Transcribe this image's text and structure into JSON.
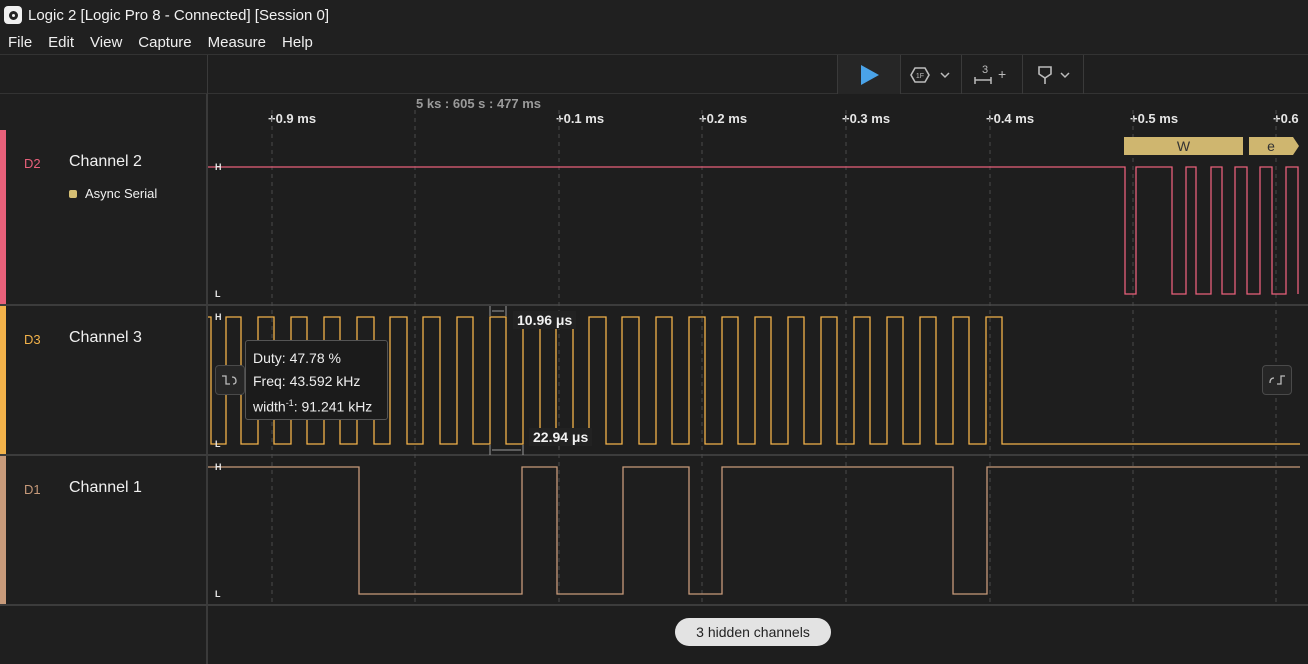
{
  "window": {
    "title": "Logic 2 [Logic Pro 8 - Connected] [Session 0]"
  },
  "menu": [
    "File",
    "Edit",
    "View",
    "Capture",
    "Measure",
    "Help"
  ],
  "toolbar": {
    "play_icon": "play-icon",
    "trigger_icon": "trigger-icon",
    "trigger_text": "1F",
    "measure_icon": "measure-icon",
    "measure_number": "3",
    "measure_plus": "+",
    "marker_icon": "marker-icon",
    "accent_color": "#4aa3e8"
  },
  "timeline": {
    "origin": "5 ks : 605 s : 477 ms",
    "ticks": [
      "+0.9 ms",
      "+0.1 ms",
      "+0.2 ms",
      "+0.3 ms",
      "+0.4 ms",
      "+0.5 ms",
      "+0.6"
    ]
  },
  "channels": [
    {
      "id": "D2",
      "name": "Channel 2",
      "color": "#e8607a",
      "analyzer": "Async Serial"
    },
    {
      "id": "D3",
      "name": "Channel 3",
      "color": "#f2b24a"
    },
    {
      "id": "D1",
      "name": "Channel 1",
      "color": "#c79a7a"
    }
  ],
  "decoded": [
    "W",
    "e"
  ],
  "high_label": "H",
  "low_label": "L",
  "tooltip": {
    "duty": "Duty: 47.78 %",
    "freq": "Freq: 43.592 kHz",
    "width_prefix": "width",
    "width_sup": "-1",
    "width_value": ": 91.241 kHz"
  },
  "measurements": {
    "width": "10.96 μs",
    "period": "22.94 μs"
  },
  "hidden_channels": "3 hidden channels"
}
